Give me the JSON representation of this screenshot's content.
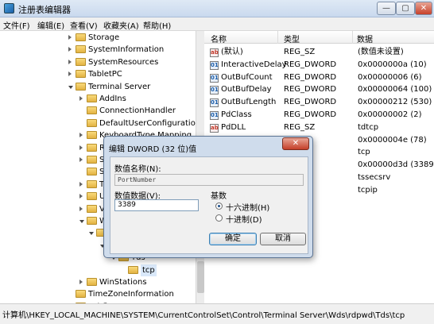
{
  "window": {
    "title": "注册表编辑器",
    "min_glyph": "—",
    "max_glyph": "▢",
    "close_glyph": "✕"
  },
  "menu": [
    "文件(F)",
    "编辑(E)",
    "查看(V)",
    "收藏夹(A)",
    "帮助(H)"
  ],
  "tree": [
    {
      "label": "Storage",
      "depth": 2,
      "state": "closed"
    },
    {
      "label": "SystemInformation",
      "depth": 2,
      "state": "closed"
    },
    {
      "label": "SystemResources",
      "depth": 2,
      "state": "closed"
    },
    {
      "label": "TabletPC",
      "depth": 2,
      "state": "closed"
    },
    {
      "label": "Terminal Server",
      "depth": 2,
      "state": "open"
    },
    {
      "label": "AddIns",
      "depth": 3,
      "state": "closed"
    },
    {
      "label": "ConnectionHandler",
      "depth": 3,
      "state": "none"
    },
    {
      "label": "DefaultUserConfiguration",
      "depth": 3,
      "state": "none"
    },
    {
      "label": "KeyboardType Mapping",
      "depth": 3,
      "state": "closed"
    },
    {
      "label": "R",
      "depth": 3,
      "state": "closed"
    },
    {
      "label": "S",
      "depth": 3,
      "state": "closed"
    },
    {
      "label": "S",
      "depth": 3,
      "state": "none"
    },
    {
      "label": "T",
      "depth": 3,
      "state": "closed"
    },
    {
      "label": "U",
      "depth": 3,
      "state": "closed"
    },
    {
      "label": "V",
      "depth": 3,
      "state": "closed"
    },
    {
      "label": "W",
      "depth": 3,
      "state": "open"
    },
    {
      "label": "",
      "depth": 4,
      "state": "open"
    },
    {
      "label": "",
      "depth": 5,
      "state": "open"
    },
    {
      "label": "Tds",
      "depth": 6,
      "state": "open"
    },
    {
      "label": "tcp",
      "depth": 7,
      "state": "none"
    },
    {
      "label": "WinStations",
      "depth": 3,
      "state": "closed"
    },
    {
      "label": "TimeZoneInformation",
      "depth": 2,
      "state": "none"
    },
    {
      "label": "usbflags",
      "depth": 2,
      "state": "closed"
    }
  ],
  "list": {
    "columns": [
      "名称",
      "类型",
      "数据"
    ],
    "rows": [
      {
        "icon": "ab",
        "kind": "sz",
        "name": "(默认)",
        "type": "REG_SZ",
        "data": "(数值未设置)"
      },
      {
        "icon": "01",
        "kind": "dw",
        "name": "InteractiveDelay",
        "type": "REG_DWORD",
        "data": "0x0000000a (10)"
      },
      {
        "icon": "01",
        "kind": "dw",
        "name": "OutBufCount",
        "type": "REG_DWORD",
        "data": "0x00000006 (6)"
      },
      {
        "icon": "01",
        "kind": "dw",
        "name": "OutBufDelay",
        "type": "REG_DWORD",
        "data": "0x00000064 (100)"
      },
      {
        "icon": "01",
        "kind": "dw",
        "name": "OutBufLength",
        "type": "REG_DWORD",
        "data": "0x00000212 (530)"
      },
      {
        "icon": "01",
        "kind": "dw",
        "name": "PdClass",
        "type": "REG_DWORD",
        "data": "0x00000002 (2)"
      },
      {
        "icon": "ab",
        "kind": "sz",
        "name": "PdDLL",
        "type": "REG_SZ",
        "data": "tdtcp"
      },
      {
        "icon": "01",
        "kind": "dw",
        "name": "",
        "type": "ORD",
        "data": "0x0000004e (78)"
      },
      {
        "icon": "",
        "kind": "",
        "name": "",
        "type": "",
        "data": "tcp"
      },
      {
        "icon": "",
        "kind": "",
        "name": "",
        "type": "ORD",
        "data": "0x00000d3d (3389)"
      },
      {
        "icon": "",
        "kind": "",
        "name": "",
        "type": "LTI_SZ",
        "data": "tssecsrv"
      },
      {
        "icon": "",
        "kind": "",
        "name": "",
        "type": "",
        "data": "tcpip"
      }
    ]
  },
  "dialog": {
    "title": "编辑 DWORD (32 位)值",
    "close_glyph": "✕",
    "name_label": "数值名称(N):",
    "name_value": "PortNumber",
    "data_label": "数值数据(V):",
    "data_value": "3389",
    "base_label": "基数",
    "hex_label": "十六进制(H)",
    "dec_label": "十进制(D)",
    "ok": "确定",
    "cancel": "取消"
  },
  "status": "计算机\\HKEY_LOCAL_MACHINE\\SYSTEM\\CurrentControlSet\\Control\\Terminal Server\\Wds\\rdpwd\\Tds\\tcp"
}
